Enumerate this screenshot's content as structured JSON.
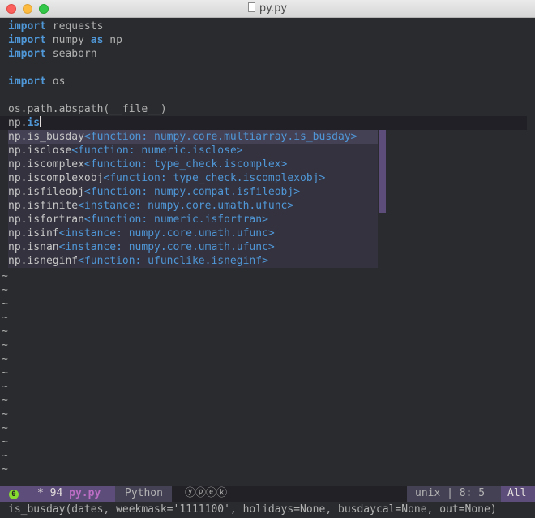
{
  "window": {
    "title": "py.py"
  },
  "code_lines": [
    {
      "kw": "import",
      "rest": " requests"
    },
    {
      "kw": "import",
      "rest": " numpy ",
      "kw2": "as",
      "rest2": " np"
    },
    {
      "kw": "import",
      "rest": " seaborn"
    },
    {
      "kw": "",
      "rest": ""
    },
    {
      "kw": "import",
      "rest": " os"
    },
    {
      "kw": "",
      "rest": ""
    },
    {
      "kw": "",
      "rest": "os.path.abspath(__file__)"
    }
  ],
  "current_line": {
    "prefix": "np.",
    "typed": "is"
  },
  "completions": [
    {
      "name": "np.is_busday",
      "annotation": "<function: numpy.core.multiarray.is_busday>"
    },
    {
      "name": "np.isclose",
      "annotation": "<function: numeric.isclose>"
    },
    {
      "name": "np.iscomplex",
      "annotation": "<function: type_check.iscomplex>"
    },
    {
      "name": "np.iscomplexobj",
      "annotation": "<function: type_check.iscomplexobj>"
    },
    {
      "name": "np.isfileobj",
      "annotation": "<function: numpy.compat.isfileobj>"
    },
    {
      "name": "np.isfinite",
      "annotation": "<instance: numpy.core.umath.ufunc>"
    },
    {
      "name": "np.isfortran",
      "annotation": "<function: numeric.isfortran>"
    },
    {
      "name": "np.isinf",
      "annotation": "<instance: numpy.core.umath.ufunc>"
    },
    {
      "name": "np.isnan",
      "annotation": "<instance: numpy.core.umath.ufunc>"
    },
    {
      "name": "np.isneginf",
      "annotation": "<function: ufunclike.isneginf>"
    }
  ],
  "tilde_char": "~",
  "modeline": {
    "state": "0",
    "modified": "* 94 ",
    "filename": "py.py",
    "major_mode": "Python",
    "minor_modes": "ⓨⓟⓔⓚ",
    "encoding": "unix | 8: 5",
    "position": "All"
  },
  "echo_area": "is_busday(dates, weekmask='1111100', holidays=None, busdaycal=None, out=None)",
  "colors": {
    "background": "#292b2e",
    "keyword": "#4f97d7",
    "accent": "#5d4d7a",
    "filename": "#bc6ec5"
  }
}
